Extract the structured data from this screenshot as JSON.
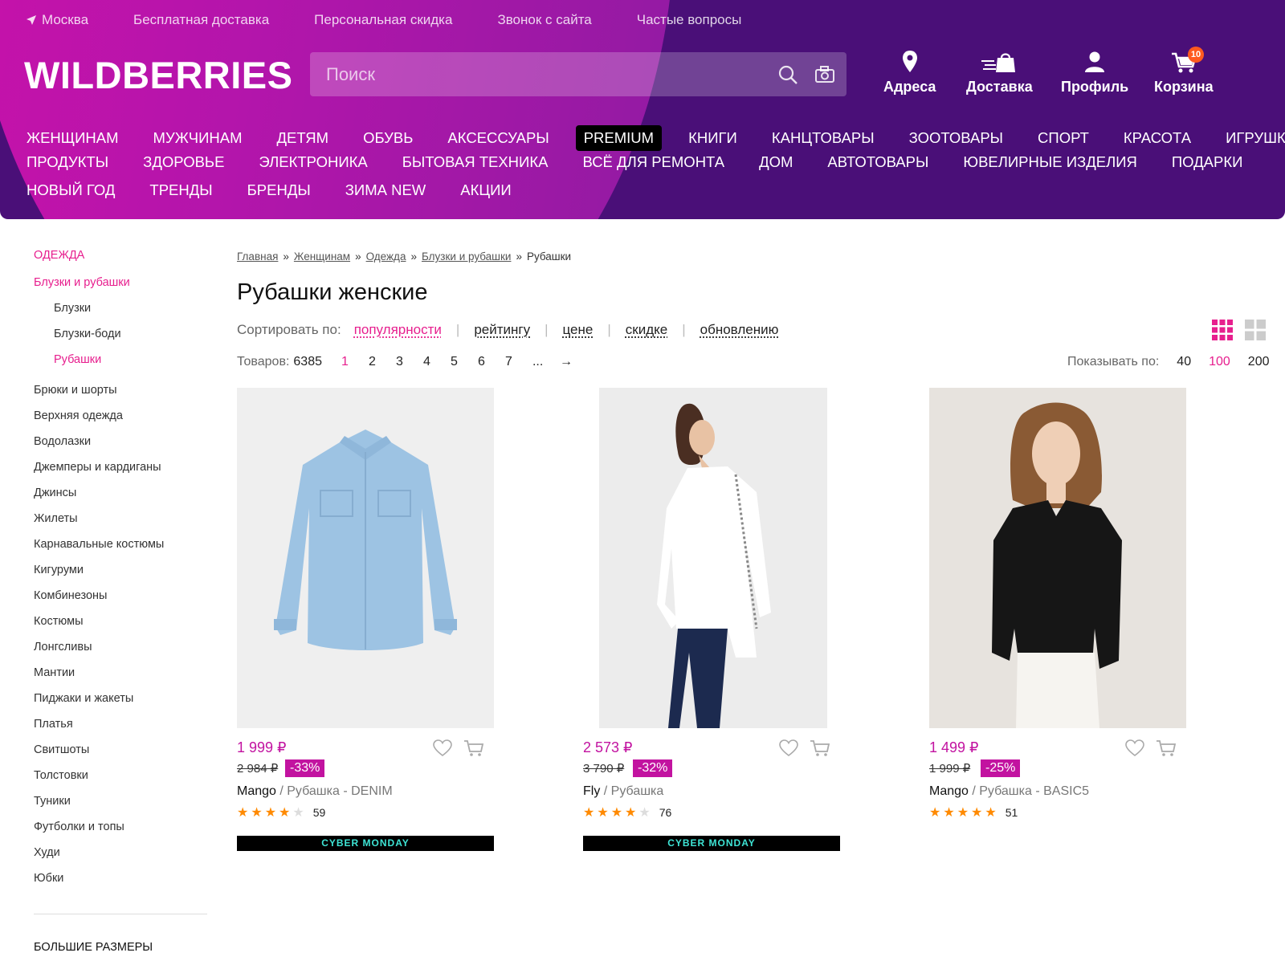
{
  "topbar": {
    "location": "Москва",
    "links": [
      "Бесплатная доставка",
      "Персональная скидка",
      "Звонок с сайта",
      "Частые вопросы"
    ]
  },
  "logo": "WILDBERRIES",
  "search": {
    "placeholder": "Поиск"
  },
  "header_buttons": {
    "address": "Адреса",
    "delivery": "Доставка",
    "profile": "Профиль",
    "cart": "Корзина",
    "cart_count": "10"
  },
  "nav": {
    "row1": [
      "ЖЕНЩИНАМ",
      "МУЖЧИНАМ",
      "ДЕТЯМ",
      "ОБУВЬ",
      "АКСЕССУАРЫ",
      "PREMIUM",
      "КНИГИ",
      "КАНЦТОВАРЫ",
      "ЗООТОВАРЫ",
      "СПОРТ",
      "КРАСОТА",
      "ИГРУШКИ"
    ],
    "row2": [
      "ПРОДУКТЫ",
      "ЗДОРОВЬЕ",
      "ЭЛЕКТРОНИКА",
      "БЫТОВАЯ ТЕХНИКА",
      "ВСЁ ДЛЯ РЕМОНТА",
      "ДОМ",
      "АВТОТОВАРЫ",
      "ЮВЕЛИРНЫЕ ИЗДЕЛИЯ",
      "ПОДАРКИ"
    ],
    "row3": [
      "НОВЫЙ ГОД",
      "ТРЕНДЫ",
      "БРЕНДЫ",
      "ЗИМА NEW",
      "АКЦИИ"
    ]
  },
  "sidebar": {
    "category": "ОДЕЖДА",
    "subcategory": "Блузки и рубашки",
    "sub_items": [
      "Блузки",
      "Блузки-боди",
      "Рубашки"
    ],
    "items": [
      "Брюки и шорты",
      "Верхняя одежда",
      "Водолазки",
      "Джемперы и кардиганы",
      "Джинсы",
      "Жилеты",
      "Карнавальные костюмы",
      "Кигуруми",
      "Комбинезоны",
      "Костюмы",
      "Лонгсливы",
      "Мантии",
      "Пиджаки и жакеты",
      "Платья",
      "Свитшоты",
      "Толстовки",
      "Туники",
      "Футболки и топы",
      "Худи",
      "Юбки"
    ],
    "big_sizes": "БОЛЬШИЕ РАЗМЕРЫ"
  },
  "breadcrumbs": {
    "items": [
      "Главная",
      "Женщинам",
      "Одежда",
      "Блузки и рубашки"
    ],
    "current": "Рубашки",
    "sep": "»"
  },
  "page_title": "Рубашки женские",
  "sort": {
    "label": "Сортировать по:",
    "options": [
      "популярности",
      "рейтингу",
      "цене",
      "скидке",
      "обновлению"
    ]
  },
  "count": {
    "label": "Товаров:",
    "value": "6385"
  },
  "pagination": {
    "pages": [
      "1",
      "2",
      "3",
      "4",
      "5",
      "6",
      "7",
      "...",
      "→"
    ]
  },
  "per_page": {
    "label": "Показывать по:",
    "options": [
      "40",
      "100",
      "200"
    ]
  },
  "products": [
    {
      "price": "1 999 ₽",
      "old_price": "2 984 ₽",
      "discount": "-33%",
      "brand": "Mango",
      "title": " / Рубашка - DENIM",
      "rating": 4,
      "reviews": "59",
      "promo": "CYBER MONDAY"
    },
    {
      "price": "2 573 ₽",
      "old_price": "3 790 ₽",
      "discount": "-32%",
      "brand": "Fly",
      "title": " / Рубашка",
      "rating": 4,
      "reviews": "76",
      "promo": "CYBER MONDAY"
    },
    {
      "price": "1 499 ₽",
      "old_price": "1 999 ₽",
      "discount": "-25%",
      "brand": "Mango",
      "title": " / Рубашка - BASIC5",
      "rating": 5,
      "reviews": "51",
      "promo": ""
    }
  ],
  "colors": {
    "brand_pink": "#e71f8e",
    "price_magenta": "#c213a0",
    "header_purple": "#4a0f78"
  }
}
